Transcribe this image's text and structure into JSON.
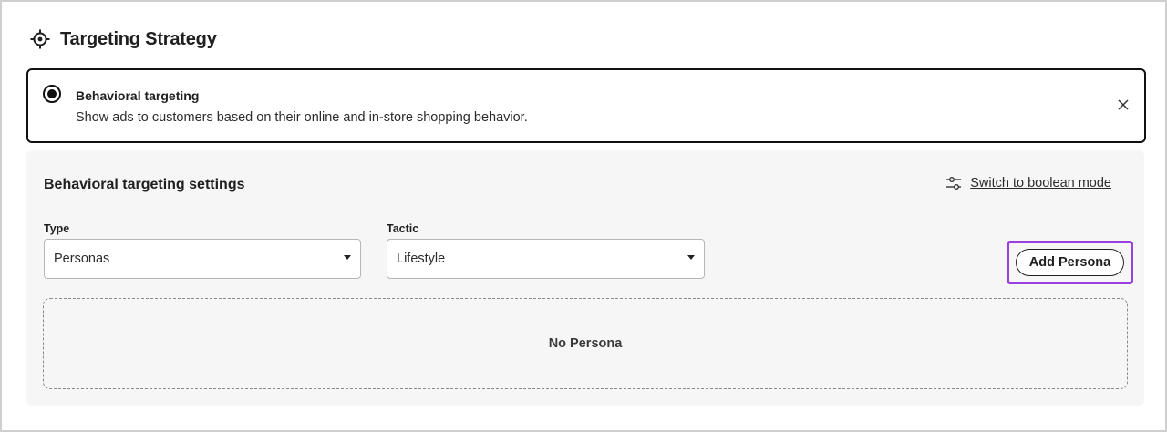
{
  "section": {
    "title": "Targeting Strategy",
    "icon": "crosshair-icon"
  },
  "option": {
    "selected": true,
    "title": "Behavioral targeting",
    "description": "Show ads to customers based on their online and in-store shopping behavior.",
    "close_icon": "close-icon"
  },
  "settings": {
    "title": "Behavioral targeting settings",
    "switch_link": "Switch to boolean mode",
    "switch_icon": "sliders-icon",
    "type": {
      "label": "Type",
      "value": "Personas"
    },
    "tactic": {
      "label": "Tactic",
      "value": "Lifestyle"
    },
    "add_button": "Add Persona",
    "empty_state": "No Persona"
  },
  "colors": {
    "highlight": "#9b3fe0",
    "panel_bg": "#f6f6f6",
    "border_dark": "#111111"
  }
}
